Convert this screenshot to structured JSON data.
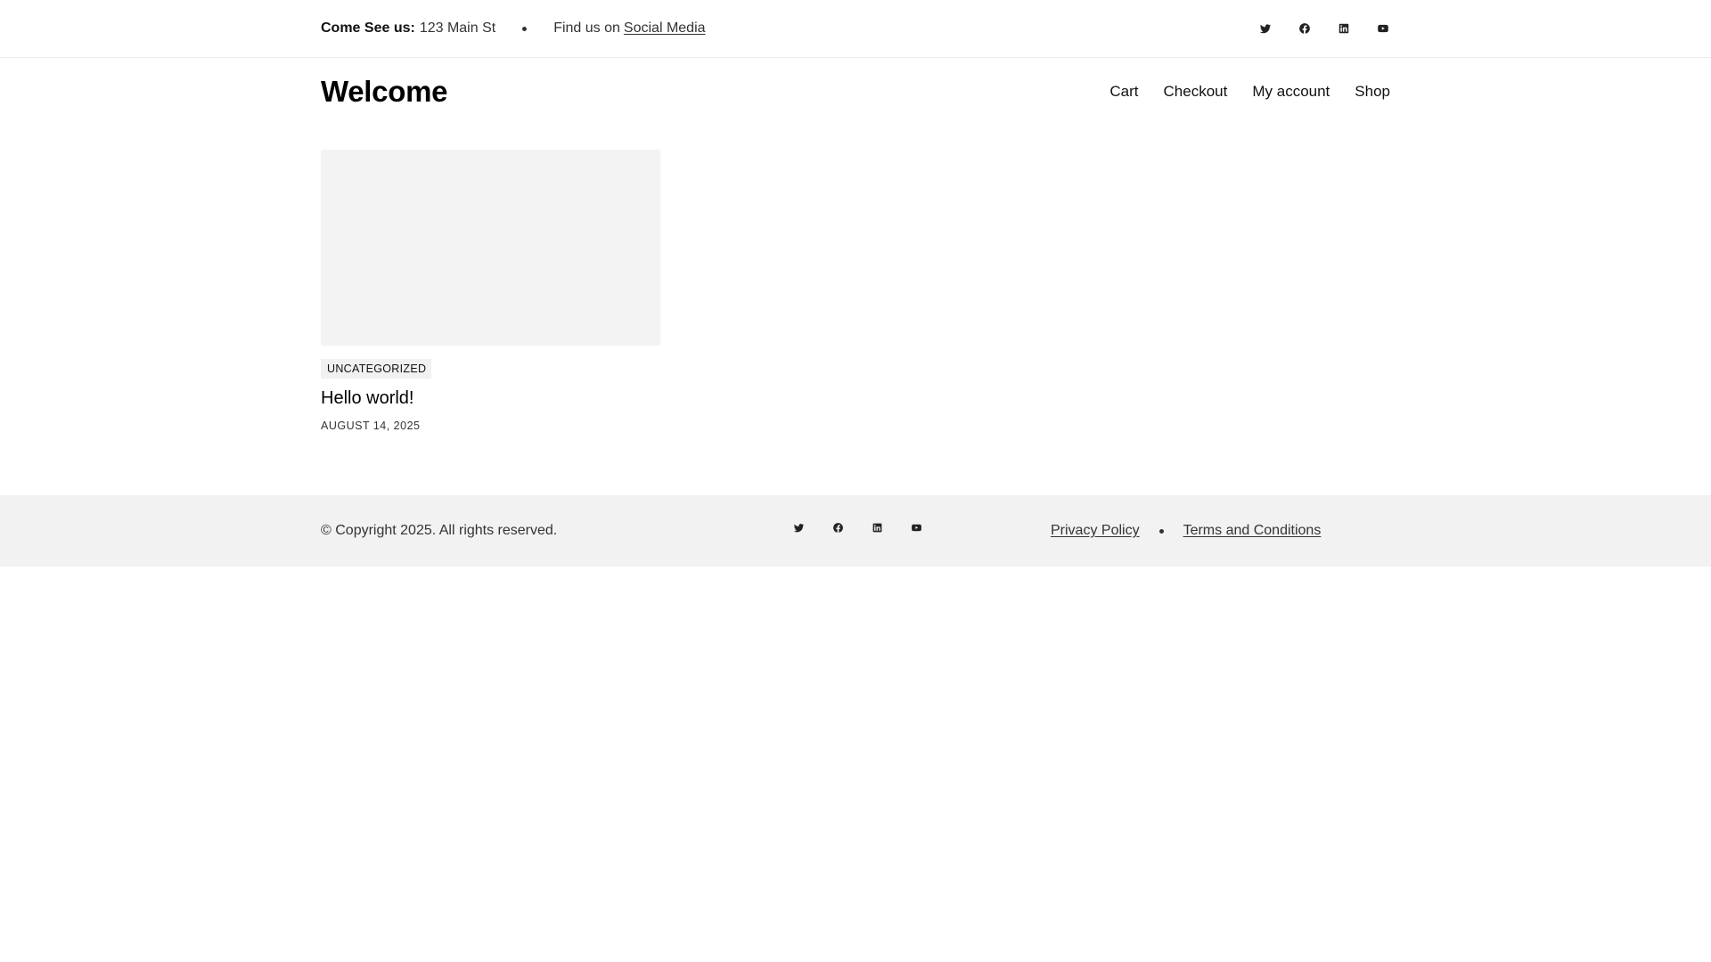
{
  "topbar": {
    "visit_label": "Come See us:",
    "address": "123 Main St",
    "find_text": "Find us on",
    "social_link": "Social Media",
    "social_icons": [
      "twitter-icon",
      "facebook-icon",
      "linkedin-icon",
      "youtube-icon"
    ]
  },
  "header": {
    "site_title": "Welcome",
    "nav": [
      "Cart",
      "Checkout",
      "My account",
      "Shop"
    ]
  },
  "post": {
    "category": "UNCATEGORIZED",
    "title": "Hello world!",
    "date": "AUGUST 14, 2025"
  },
  "footer": {
    "copyright": "© Copyright 2025. All rights reserved.",
    "social_icons": [
      "twitter-icon",
      "facebook-icon",
      "linkedin-icon",
      "youtube-icon"
    ],
    "links": [
      "Privacy Policy",
      "Terms and Conditions"
    ]
  }
}
